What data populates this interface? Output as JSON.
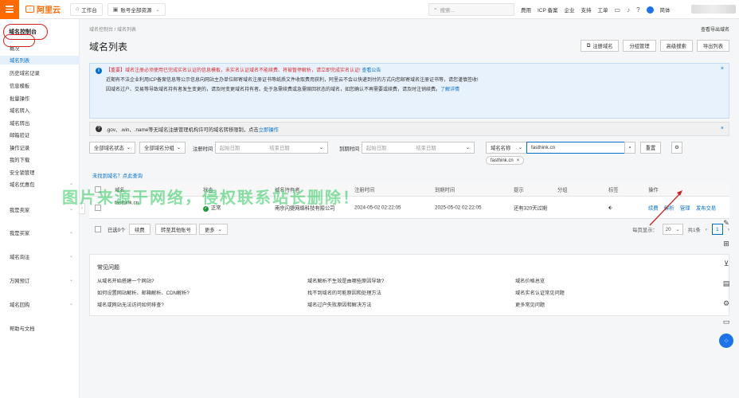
{
  "topbar": {
    "logo_text": "阿里云",
    "workbench": "工作台",
    "account_scope": "账号全部资源",
    "search_placeholder": "搜索...",
    "links": [
      "费用",
      "ICP 备案",
      "企业",
      "支持",
      "工单"
    ],
    "lang": "简体"
  },
  "sidebar": {
    "title": "域名控制台",
    "items": [
      "概况",
      "域名列表",
      "历史域名记录",
      "信息模板",
      "批量操作",
      "域名转入",
      "域名转出",
      "邮箱验证",
      "操作记录",
      "我的下载",
      "安全锁管理"
    ],
    "groups": [
      "域名优惠包",
      "我是卖家",
      "我是买家",
      "域名询注",
      "万网预订",
      "域名回购",
      "帮助与文档"
    ]
  },
  "main": {
    "breadcrumb": "域名控制台  /  域名列表",
    "help": "查看导出域名",
    "title": "域名列表",
    "buttons": [
      "注册域名",
      "分组管理",
      "高级搜索",
      "导出列表"
    ]
  },
  "notice": {
    "line1_red": "【重要】域名注册必须使用已完成实名认证的信息模板，未实名认证域名不能续费、将被暂停解析，请立即完成实名认证!",
    "line1_link": "查看公告",
    "line2": "近期有不法企业利用ICP备案信息等公示信息向网站主办单位邮寄域名注册证书等纸质文件收取费用获利，阿里云不会以快递到付的方式向您邮寄域名注册证书等，请您谨慎签收!",
    "line3": "因域名过户、交易等导致域名持有者发生变更的，请及时变更域名持有者。处于急需续费或急需赎回状态的域名，如您确认不再需要或续费，请及时注销续费。",
    "line3_link": "了解详情"
  },
  "tip": {
    "text": ".gov、.win、.name等无域名注册管理机构许可的域名转移限制，点击",
    "link": "立即操作"
  },
  "filters": {
    "status": "全部域名状态",
    "group": "全部域名分组",
    "reg_label": "注册时间",
    "start_ph": "起始日期",
    "end_ph": "结束日期",
    "exp_label": "到期时间",
    "search_type": "域名名称",
    "search_value": "fasthink.cn",
    "reset": "重置",
    "chip": "fasthink.cn"
  },
  "not_found": "未找到域名？点此查询",
  "table": {
    "headers": [
      "域名",
      "状态",
      "域名持有者",
      "注册时间",
      "到期时间",
      "提示",
      "分组",
      "标签",
      "操作"
    ],
    "rows": [
      {
        "domain": "fasthink.cn",
        "status": "正常",
        "holder": "南京闪捷网络科技有限公司",
        "reg": "2024-05-02 02:22:05",
        "exp": "2025-05-02 02:22:05",
        "hint": "还有320天过期",
        "ops": [
          "续费",
          "解析",
          "管理",
          "发布交易"
        ]
      }
    ]
  },
  "bottom": {
    "selected": "已选0个",
    "renew": "续费",
    "transfer": "转至其他账号",
    "more": "更多",
    "page_size_label": "每页显示：",
    "page_size": "20",
    "total": "共1条",
    "page": "1"
  },
  "faq": {
    "title": "常见问题",
    "items": [
      "从域名开始搭建一个网站?",
      "域名解析不生效是由哪些原因导致?",
      "域名价格总览",
      "如何设置网站解析、邮箱解析、CDN解析?",
      "找不到域名的可能原因和处理方法",
      "域名实名认证常见问题",
      "域名或网站无法访问如何排查?",
      "域名过户失败原因和解决方法",
      "更多常见问题"
    ]
  },
  "watermark": "图片来源于网络，侵权联系站长删除！"
}
